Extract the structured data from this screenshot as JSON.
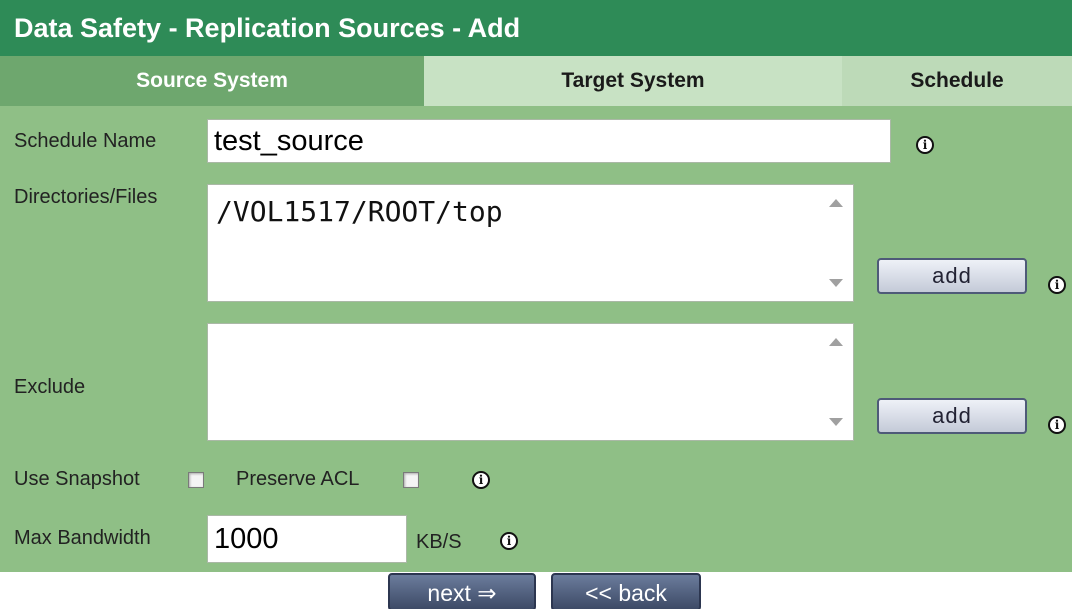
{
  "title": "Data Safety - Replication Sources - Add",
  "tabs": [
    {
      "label": "Source System"
    },
    {
      "label": "Target System"
    },
    {
      "label": "Schedule"
    }
  ],
  "form": {
    "schedule_name": {
      "label": "Schedule Name",
      "value": "test_source"
    },
    "directories": {
      "label": "Directories/Files",
      "value": "/VOL1517/ROOT/top",
      "add_label": "add"
    },
    "exclude": {
      "label": "Exclude",
      "value": "",
      "add_label": "add"
    },
    "use_snapshot": {
      "label": "Use Snapshot",
      "checked": false
    },
    "preserve_acl": {
      "label": "Preserve ACL",
      "checked": false
    },
    "max_bandwidth": {
      "label": "Max Bandwidth",
      "value": "1000",
      "unit": "KB/S"
    },
    "info_glyph": "i"
  },
  "nav": {
    "next_label": "next ⇒",
    "back_label": "<< back"
  },
  "colors": {
    "title_bg": "#2e8b57",
    "active_tab_bg": "#6ea76e",
    "form_bg": "#8fbf86"
  }
}
